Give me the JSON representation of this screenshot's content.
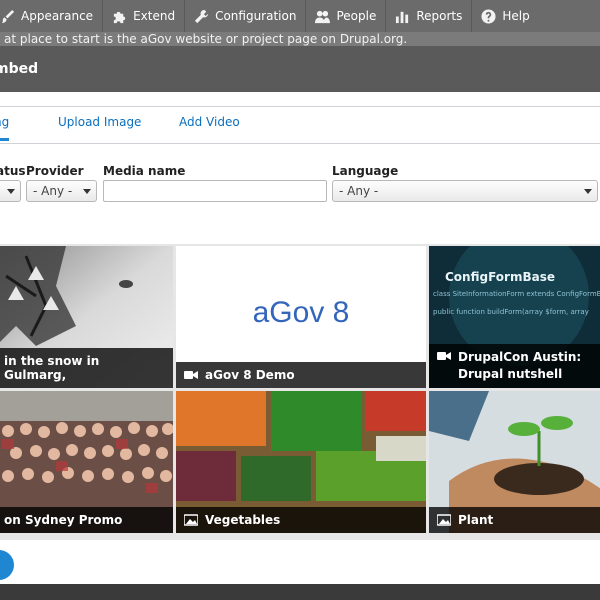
{
  "admin_toolbar": {
    "items": [
      {
        "label": "Appearance",
        "icon": "paintbrush-icon"
      },
      {
        "label": "Extend",
        "icon": "puzzle-icon"
      },
      {
        "label": "Configuration",
        "icon": "wrench-icon"
      },
      {
        "label": "People",
        "icon": "people-icon"
      },
      {
        "label": "Reports",
        "icon": "bar-chart-icon"
      },
      {
        "label": "Help",
        "icon": "help-icon"
      }
    ]
  },
  "background_message": "at place to start is the aGov website or project page on Drupal.org.",
  "dialog": {
    "title": "mbed"
  },
  "tabs": [
    {
      "label": "ng",
      "active": true
    },
    {
      "label": "Upload Image",
      "active": false
    },
    {
      "label": "Add Video",
      "active": false
    }
  ],
  "filters": {
    "status_label": "atus",
    "provider_label": "Provider",
    "provider_value": "- Any -",
    "media_name_label": "Media name",
    "media_name_value": "",
    "language_label": "Language",
    "language_value": "- Any -"
  },
  "media": [
    {
      "name": "in the snow in Gulmarg,",
      "type": "video"
    },
    {
      "name": "aGov 8 Demo",
      "type": "video",
      "logo_text": "aGov 8"
    },
    {
      "name": "DrupalCon Austin: Drupal nutshell",
      "type": "video",
      "overlay_title": "ConfigFormBase",
      "overlay_code_line1": "class SiteInformationForm extends ConfigFormBase",
      "overlay_code_line2": "public function buildForm(array $form, array"
    },
    {
      "name": "on Sydney Promo",
      "type": "video"
    },
    {
      "name": "Vegetables",
      "type": "image"
    },
    {
      "name": "Plant",
      "type": "image"
    }
  ],
  "colors": {
    "accent": "#1f86d1",
    "link": "#0b6fbf",
    "toolbar": "#6b6b6b",
    "overlay": "#5a5a5a"
  }
}
